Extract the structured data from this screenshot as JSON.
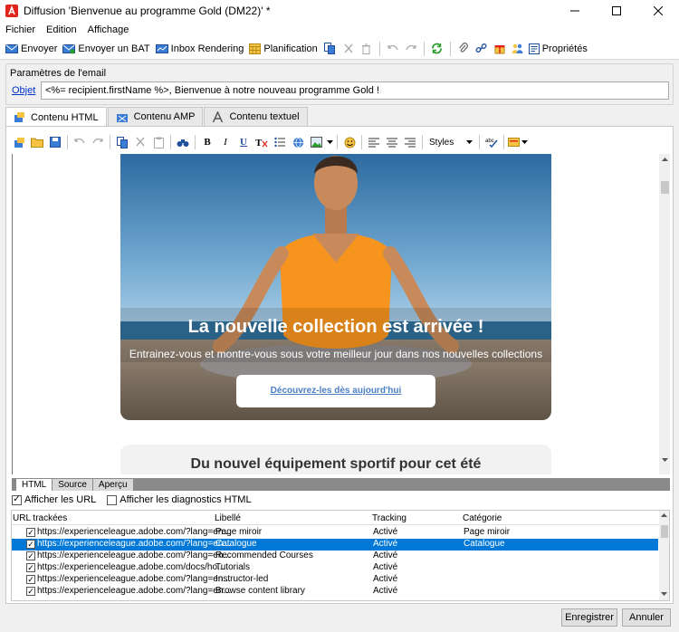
{
  "window": {
    "title": "Diffusion 'Bienvenue au programme Gold (DM22)' *",
    "minimize_icon": "minimize-icon",
    "maximize_icon": "maximize-icon",
    "close_icon": "close-icon"
  },
  "menu": {
    "items": [
      "Fichier",
      "Edition",
      "Affichage"
    ]
  },
  "toolbar": {
    "send": "Envoyer",
    "send_proof": "Envoyer un BAT",
    "inbox_rendering": "Inbox Rendering",
    "planning": "Planification",
    "properties": "Propriétés"
  },
  "email_params": {
    "legend": "Paramètres de l'email",
    "subject_label": "Objet",
    "subject_value": "<%= recipient.firstName %>, Bienvenue à notre nouveau programme Gold !"
  },
  "content_tabs": [
    "Contenu HTML",
    "Contenu AMP",
    "Contenu textuel"
  ],
  "editor_toolbar": {
    "styles_label": "Styles"
  },
  "preview": {
    "hero_title": "La nouvelle collection est arrivée !",
    "hero_subtitle": "Entrainez-vous et montre-vous sous votre meilleur jour dans nos nouvelles collections",
    "cta_label": "Découvrez-les dès aujourd'hui",
    "section_title": "Du nouvel équipement sportif pour cet été"
  },
  "source_tabs": [
    "HTML",
    "Source",
    "Aperçu"
  ],
  "url_options": {
    "show_urls": "Afficher les URL",
    "show_diagnostics": "Afficher les diagnostics HTML"
  },
  "url_table": {
    "headers": [
      "URL trackées",
      "Libellé",
      "Tracking",
      "Catégorie"
    ],
    "rows": [
      {
        "url": "https://experienceleague.adobe.com/?lang=en...",
        "label": "Page miroir",
        "tracking": "Activé",
        "category": "Page miroir"
      },
      {
        "url": "https://experienceleague.adobe.com/?lang=en...",
        "label": "Catalogue",
        "tracking": "Activé",
        "category": "Catalogue"
      },
      {
        "url": "https://experienceleague.adobe.com/?lang=en...",
        "label": "Recommended Courses",
        "tracking": "Activé",
        "category": ""
      },
      {
        "url": "https://experienceleague.adobe.com/docs/ho...",
        "label": "Tutorials",
        "tracking": "Activé",
        "category": ""
      },
      {
        "url": "https://experienceleague.adobe.com/?lang=en...",
        "label": "Instructor-led",
        "tracking": "Activé",
        "category": ""
      },
      {
        "url": "https://experienceleague.adobe.com/?lang=en...",
        "label": "Browse content library",
        "tracking": "Activé",
        "category": ""
      }
    ]
  },
  "buttons": {
    "save": "Enregistrer",
    "cancel": "Annuler"
  },
  "colors": {
    "selection": "#0078d7",
    "adobe_red": "#e1251b",
    "link": "#0033cc",
    "hero_shirt": "#f7941d"
  }
}
